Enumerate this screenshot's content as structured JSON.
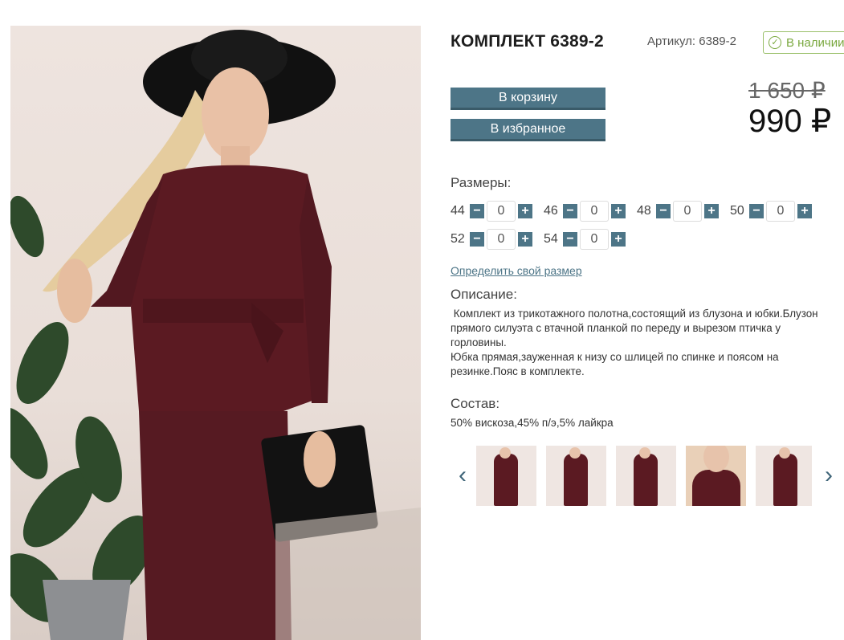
{
  "product": {
    "title": "КОМПЛЕКТ 6389-2",
    "article": "Артикул: 6389-2",
    "stock": "В наличии",
    "old_price": "1 650 ₽",
    "new_price": "990 ₽"
  },
  "buttons": {
    "cart": "В корзину",
    "favorite": "В избранное"
  },
  "sizes": {
    "label": "Размеры:",
    "row1": [
      {
        "size": "44",
        "qty": "0"
      },
      {
        "size": "46",
        "qty": "0"
      },
      {
        "size": "48",
        "qty": "0"
      },
      {
        "size": "50",
        "qty": "0"
      }
    ],
    "row2": [
      {
        "size": "52",
        "qty": "0"
      },
      {
        "size": "54",
        "qty": "0"
      }
    ],
    "find_size_link": "Определить свой размер"
  },
  "description": {
    "label": "Описание:",
    "text": " Комплект из трикотажного полотна,состоящий из блузона и юбки.Блузон\nпрямого силуэта с втачной планкой по переду и вырезом птичка у\nгорловины.\nЮбка прямая,зауженная к низу со шлицей по спинке и поясом на\nрезинке.Пояс в комплекте."
  },
  "composition": {
    "label": "Состав:",
    "text": "50% вискоза,45% п/э,5% лайкра"
  },
  "gallery": {
    "prev_icon": "chevron-left-icon",
    "next_icon": "chevron-right-icon",
    "thumbnails_count": 5
  },
  "colors": {
    "accent": "#4d7587",
    "stock_green": "#7aa83f",
    "garment": "#5b1a22"
  }
}
